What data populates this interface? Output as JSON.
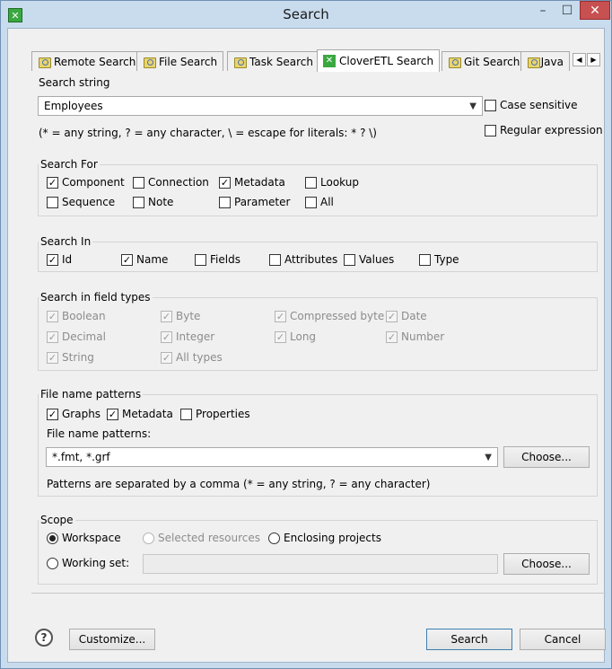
{
  "window": {
    "title": "Search"
  },
  "tabs": [
    {
      "label": "Remote Search",
      "icon": "search-icon"
    },
    {
      "label": "File Search",
      "icon": "search-icon"
    },
    {
      "label": "Task Search",
      "icon": "search-icon"
    },
    {
      "label": "CloverETL Search",
      "icon": "clover-icon"
    },
    {
      "label": "Git Search",
      "icon": "search-icon"
    },
    {
      "label": "Java",
      "icon": "search-icon"
    }
  ],
  "search_string": {
    "label": "Search string",
    "value": "Employees",
    "case_sensitive": "Case sensitive",
    "regular_expression": "Regular expression",
    "hint": "(* = any string, ? = any character, \\ = escape for literals: * ? \\)"
  },
  "search_for": {
    "title": "Search For",
    "items": [
      {
        "label": "Component",
        "checked": true
      },
      {
        "label": "Connection",
        "checked": false
      },
      {
        "label": "Metadata",
        "checked": true
      },
      {
        "label": "Lookup",
        "checked": false
      },
      {
        "label": "Sequence",
        "checked": false
      },
      {
        "label": "Note",
        "checked": false
      },
      {
        "label": "Parameter",
        "checked": false
      },
      {
        "label": "All",
        "checked": false
      }
    ]
  },
  "search_in": {
    "title": "Search In",
    "items": [
      {
        "label": "Id",
        "checked": true
      },
      {
        "label": "Name",
        "checked": true
      },
      {
        "label": "Fields",
        "checked": false
      },
      {
        "label": "Attributes",
        "checked": false
      },
      {
        "label": "Values",
        "checked": false
      },
      {
        "label": "Type",
        "checked": false
      }
    ]
  },
  "field_types": {
    "title": "Search in field types",
    "items": [
      {
        "label": "Boolean",
        "checked": true
      },
      {
        "label": "Byte",
        "checked": true
      },
      {
        "label": "Compressed byte",
        "checked": true
      },
      {
        "label": "Date",
        "checked": true
      },
      {
        "label": "Decimal",
        "checked": true
      },
      {
        "label": "Integer",
        "checked": true
      },
      {
        "label": "Long",
        "checked": true
      },
      {
        "label": "Number",
        "checked": true
      },
      {
        "label": "String",
        "checked": true
      },
      {
        "label": "All types",
        "checked": true
      }
    ]
  },
  "file_patterns": {
    "title": "File name patterns",
    "items": [
      {
        "label": "Graphs",
        "checked": true
      },
      {
        "label": "Metadata",
        "checked": true
      },
      {
        "label": "Properties",
        "checked": false
      }
    ],
    "patterns_label": "File name patterns:",
    "patterns_value": "*.fmt, *.grf",
    "choose": "Choose...",
    "hint": "Patterns are separated by a comma (* = any string, ? = any character)"
  },
  "scope": {
    "title": "Scope",
    "workspace": "Workspace",
    "selected_resources": "Selected resources",
    "enclosing_projects": "Enclosing projects",
    "working_set": "Working set:",
    "choose": "Choose..."
  },
  "footer": {
    "customize": "Customize...",
    "search": "Search",
    "cancel": "Cancel"
  }
}
